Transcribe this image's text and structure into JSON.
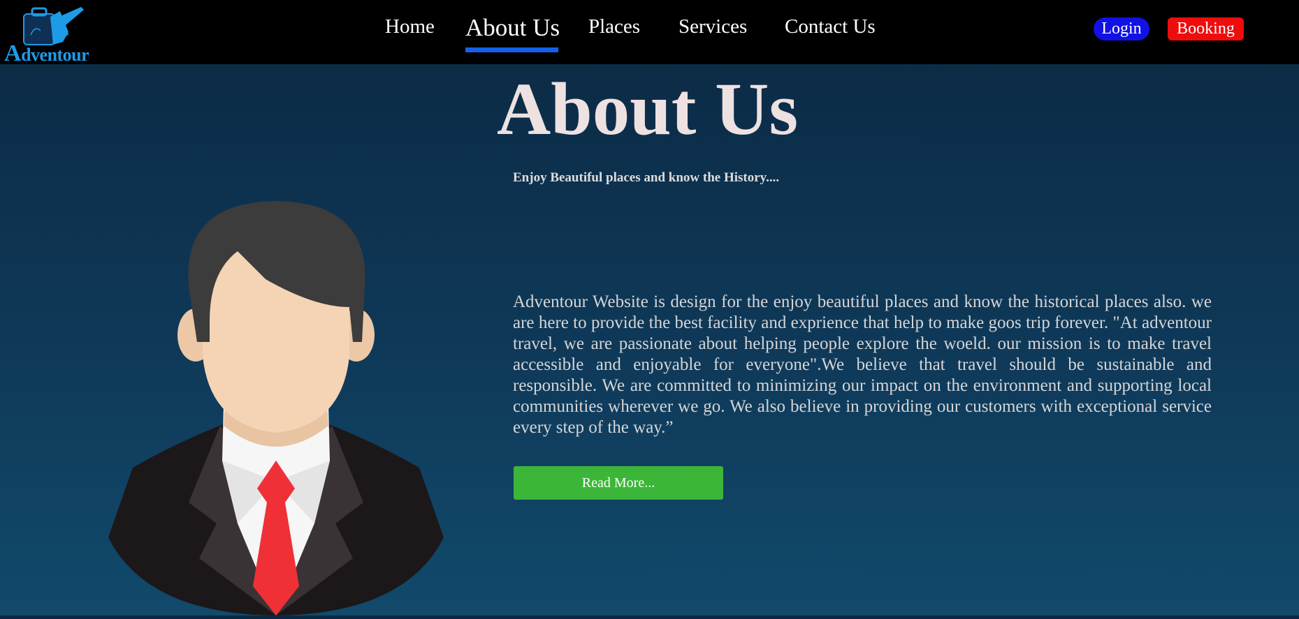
{
  "brand": {
    "logo_initial": "A",
    "logo_rest": "dventour"
  },
  "nav": {
    "items": [
      {
        "label": "Home"
      },
      {
        "label": "About Us",
        "active": true
      },
      {
        "label": "Places"
      },
      {
        "label": "Services"
      },
      {
        "label": "Contact Us"
      }
    ],
    "login_label": "Login",
    "booking_label": "Booking"
  },
  "hero": {
    "title": "About Us",
    "tagline": "Enjoy Beautiful places and know the History....",
    "description": "Adventour Website is design for the enjoy beautiful places and know the historical places also. we are here to provide the best facility and exprience that help to make goos trip forever. \"At adventour travel, we are passionate about helping people explore the woeld. our mission is to make travel accessible and enjoyable for everyone\".We believe that travel should be sustainable and responsible. We are committed to minimizing our impact on the environment and supporting local communities wherever we go. We also believe in providing our customers with exceptional service every step of the way.”",
    "read_more_label": "Read More..."
  },
  "icons": {
    "logo": "suitcase-plane-icon",
    "avatar": "businessman-avatar"
  },
  "colors": {
    "navbar_bg": "#000000",
    "nav_active_underline": "#1560e8",
    "login_bg": "#1111e6",
    "booking_bg": "#ee0c0c",
    "read_more_bg": "#3cb638",
    "logo_blue": "#1e9be6"
  }
}
